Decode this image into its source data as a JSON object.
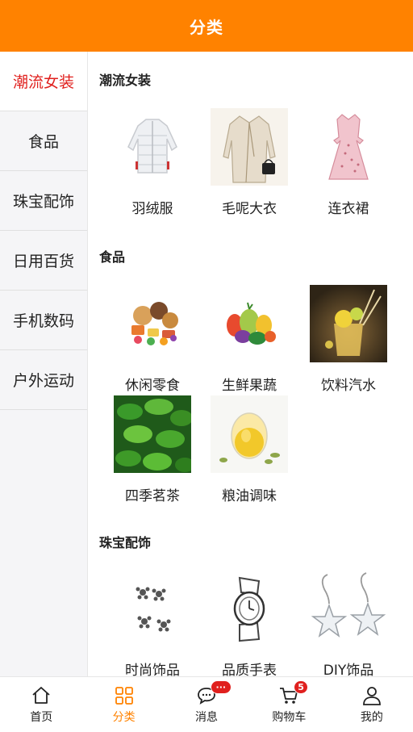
{
  "header": {
    "title": "分类"
  },
  "sidebar": {
    "items": [
      {
        "label": "潮流女装",
        "active": true
      },
      {
        "label": "食品",
        "active": false
      },
      {
        "label": "珠宝配饰",
        "active": false
      },
      {
        "label": "日用百货",
        "active": false
      },
      {
        "label": "手机数码",
        "active": false
      },
      {
        "label": "户外运动",
        "active": false
      }
    ]
  },
  "sections": [
    {
      "title": "潮流女装",
      "items": [
        {
          "label": "羽绒服",
          "icon": "down-jacket-image"
        },
        {
          "label": "毛呢大衣",
          "icon": "wool-coat-image"
        },
        {
          "label": "连衣裙",
          "icon": "dress-image"
        }
      ]
    },
    {
      "title": "食品",
      "items": [
        {
          "label": "休闲零食",
          "icon": "snacks-image"
        },
        {
          "label": "生鲜果蔬",
          "icon": "fruits-vegetables-image"
        },
        {
          "label": "饮料汽水",
          "icon": "drinks-image"
        },
        {
          "label": "四季茗茶",
          "icon": "tea-leaves-image"
        },
        {
          "label": "粮油调味",
          "icon": "cooking-oil-image"
        }
      ]
    },
    {
      "title": "珠宝配饰",
      "items": [
        {
          "label": "时尚饰品",
          "icon": "earring-studs-image"
        },
        {
          "label": "品质手表",
          "icon": "watch-image"
        },
        {
          "label": "DIY饰品",
          "icon": "star-earrings-image"
        }
      ]
    }
  ],
  "tabbar": {
    "items": [
      {
        "label": "首页",
        "icon": "home-icon"
      },
      {
        "label": "分类",
        "icon": "category-icon",
        "active": true
      },
      {
        "label": "消息",
        "icon": "message-icon",
        "badge": "···"
      },
      {
        "label": "购物车",
        "icon": "cart-icon",
        "badge": "5"
      },
      {
        "label": "我的",
        "icon": "profile-icon"
      }
    ]
  },
  "colors": {
    "brand": "#ff8200",
    "active_text": "#e0201e",
    "badge": "#e0201e"
  }
}
